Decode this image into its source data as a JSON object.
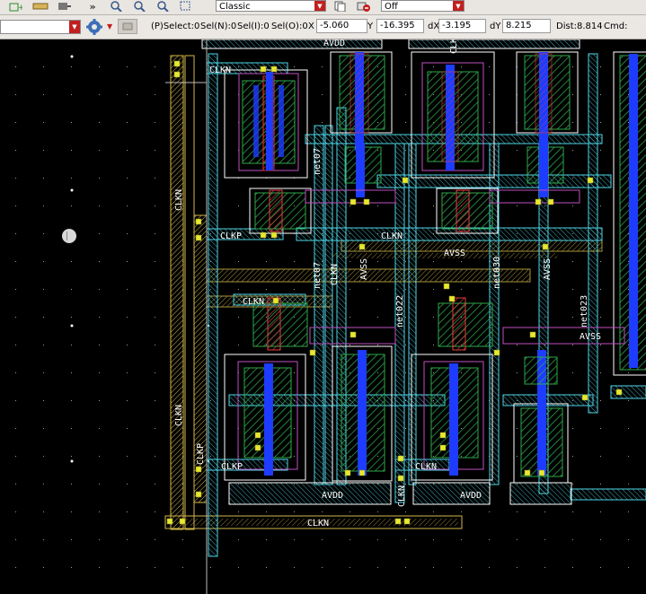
{
  "toolbar": {
    "overflow_label": "»",
    "style_combo": "Classic",
    "mode_combo": "Off"
  },
  "status": {
    "layer_combo": "",
    "p_select": "(P)Select:0",
    "sel_n": "Sel(N):0",
    "sel_i": "Sel(I):0",
    "sel_o": "Sel(O):0",
    "x_label": "X",
    "x_value": "-5.060",
    "y_label": "Y",
    "y_value": "-16.395",
    "dx_label": "dX",
    "dx_value": "-3.195",
    "dy_label": "dY",
    "dy_value": "8.215",
    "dist": "Dist:8.814",
    "cmd": "Cmd:"
  },
  "layout_labels": {
    "clkn_top": "CLKN",
    "clkn_vertical_top": "CLKN",
    "clkp_mid": "CLKP",
    "clkn_center": "CLKN",
    "avss_center": "AVSS",
    "clkn_row2": "CLKN",
    "net07_a": "net07",
    "net07_b": "net07",
    "clkn_v_small": "CLKN",
    "avss_v1": "AVSS",
    "net022": "net022",
    "net030": "net030",
    "avss_v2": "AVSS",
    "net023": "net023",
    "avss_right": "AVSS",
    "clkn_vertical_bottom": "CLKN",
    "clkp_vertical": "CLKP",
    "clkp_bottom": "CLKP",
    "clkn_bottom_mid": "CLKN",
    "avdd_bottom1": "AVDD",
    "avdd_bottom2": "AVDD",
    "clkn_v_bottom": "CLKN",
    "clkn_bottom": "CLKN",
    "avdd_top": "AVDD",
    "clk_top": "CLK"
  },
  "colors": {
    "background": "#000000",
    "metal1": "#1e3cff",
    "metal2": "#4fd6e8",
    "poly": "#e23b3b",
    "diff": "#2ea84a",
    "via": "#e8e830",
    "boundary": "#ffffff",
    "nwell": "#c050c0"
  }
}
